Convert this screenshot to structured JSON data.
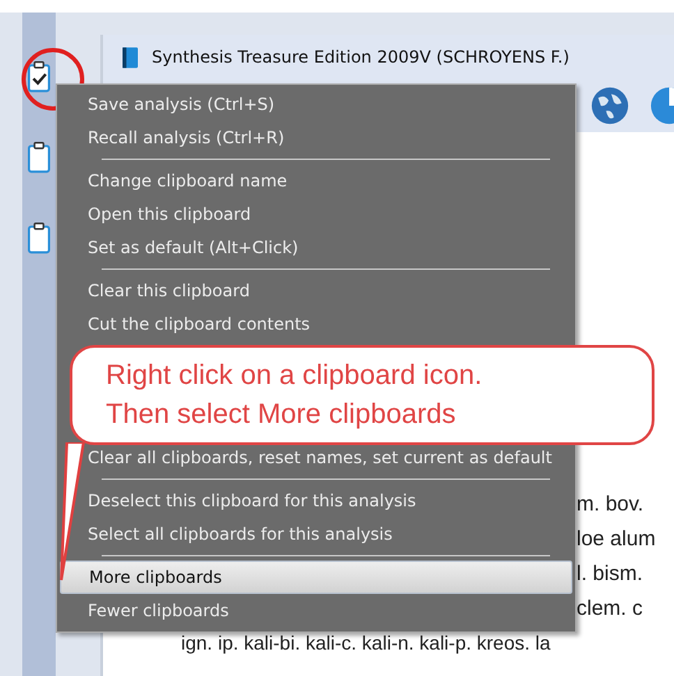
{
  "window": {
    "title": "Synthesis Treasure Edition 2009V (SCHROYENS F.)"
  },
  "content_lines": [
    {
      "text": "m. bov.",
      "kind": "tail"
    },
    {
      "text": "loe alum",
      "kind": "tail"
    },
    {
      "text": "l. bism.",
      "kind": "tail"
    },
    {
      "text": "clem. c",
      "kind": "tail"
    },
    {
      "text": "ign. ip. kali-bi. kali-c. kali-n. kali-p. kreos. la",
      "kind": "full"
    }
  ],
  "context_menu": {
    "items": [
      {
        "kind": "item",
        "label": "Save analysis (Ctrl+S)",
        "selected": false
      },
      {
        "kind": "item",
        "label": "Recall analysis (Ctrl+R)",
        "selected": false
      },
      {
        "kind": "separator"
      },
      {
        "kind": "item",
        "label": "Change clipboard name",
        "selected": false
      },
      {
        "kind": "item",
        "label": "Open this clipboard",
        "selected": false
      },
      {
        "kind": "item",
        "label": "Set as default (Alt+Click)",
        "selected": false
      },
      {
        "kind": "separator"
      },
      {
        "kind": "item",
        "label": "Clear this clipboard",
        "selected": false
      },
      {
        "kind": "item",
        "label": "Cut the clipboard contents",
        "selected": false
      },
      {
        "kind": "covered"
      },
      {
        "kind": "item",
        "label": "Clear all clipboards, reset names, set current as default",
        "selected": false
      },
      {
        "kind": "separator"
      },
      {
        "kind": "item",
        "label": "Deselect this clipboard for this analysis",
        "selected": false
      },
      {
        "kind": "item",
        "label": "Select all clipboards for this analysis",
        "selected": false
      },
      {
        "kind": "separator"
      },
      {
        "kind": "item",
        "label": "More clipboards",
        "selected": true
      },
      {
        "kind": "item",
        "label": "Fewer clipboards",
        "selected": false
      }
    ]
  },
  "callout": {
    "lines": [
      "Right click on a clipboard icon.",
      "Then select More clipboards"
    ]
  }
}
